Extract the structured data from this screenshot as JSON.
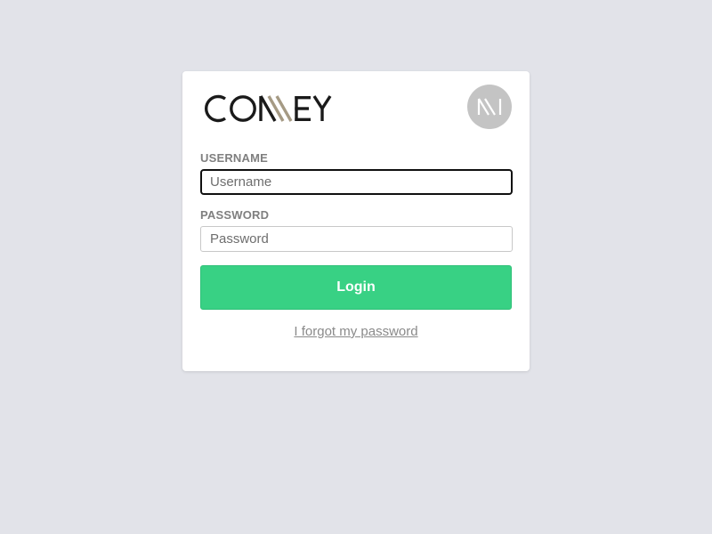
{
  "brand": {
    "logo_text": "CONNEY",
    "dark_color": "#1a1a1a",
    "accent_color": "#a59a84"
  },
  "avatar": {
    "icon": "monogram-icon",
    "background": "#c4c4c4"
  },
  "form": {
    "username_label": "USERNAME",
    "username_placeholder": "Username",
    "username_value": "",
    "password_label": "PASSWORD",
    "password_placeholder": "Password",
    "password_value": "",
    "login_label": "Login",
    "forgot_label": "I forgot my password"
  },
  "colors": {
    "page_background": "#e2e3e9",
    "login_button": "#38d184",
    "label": "#7f7f7f"
  }
}
